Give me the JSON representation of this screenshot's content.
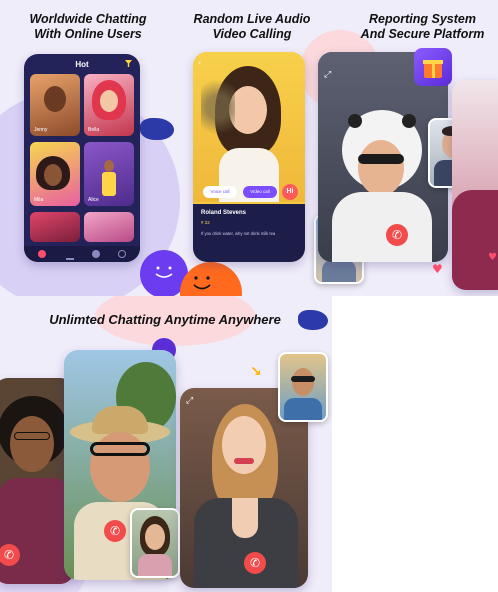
{
  "panels": {
    "chatting": {
      "caption_line1": "Worldwide Chatting",
      "caption_line2": "With Online Users"
    },
    "calling": {
      "caption_line1": "Random Live Audio",
      "caption_line2": "Video Calling"
    },
    "reporting": {
      "caption_line1": "Reporting System",
      "caption_line2": "And Secure Platform"
    },
    "unlimited": {
      "caption": "Unlimted Chatting Anytime Anywhere"
    }
  },
  "hot_screen": {
    "title": "Hot",
    "users": [
      {
        "name": "Jenny"
      },
      {
        "name": "Bella"
      },
      {
        "name": "Mila"
      },
      {
        "name": "Alice"
      },
      {
        "name": ""
      },
      {
        "name": ""
      }
    ]
  },
  "profile_card": {
    "name": "Roland Stevens",
    "id": "# 22",
    "message": "If you drink water, why not drink milk tea",
    "btn_audio": "Voice call",
    "btn_video": "Video call",
    "hi": "Hi"
  },
  "icons": {
    "hangup": "phone-hangup-icon",
    "gift": "gift-icon",
    "heart": "heart-icon",
    "expand": "expand-icon",
    "filter": "filter-icon"
  },
  "colors": {
    "accent_purple": "#7b4dff",
    "hangup_red": "#f24b4b",
    "orange": "#ff7b2c"
  }
}
